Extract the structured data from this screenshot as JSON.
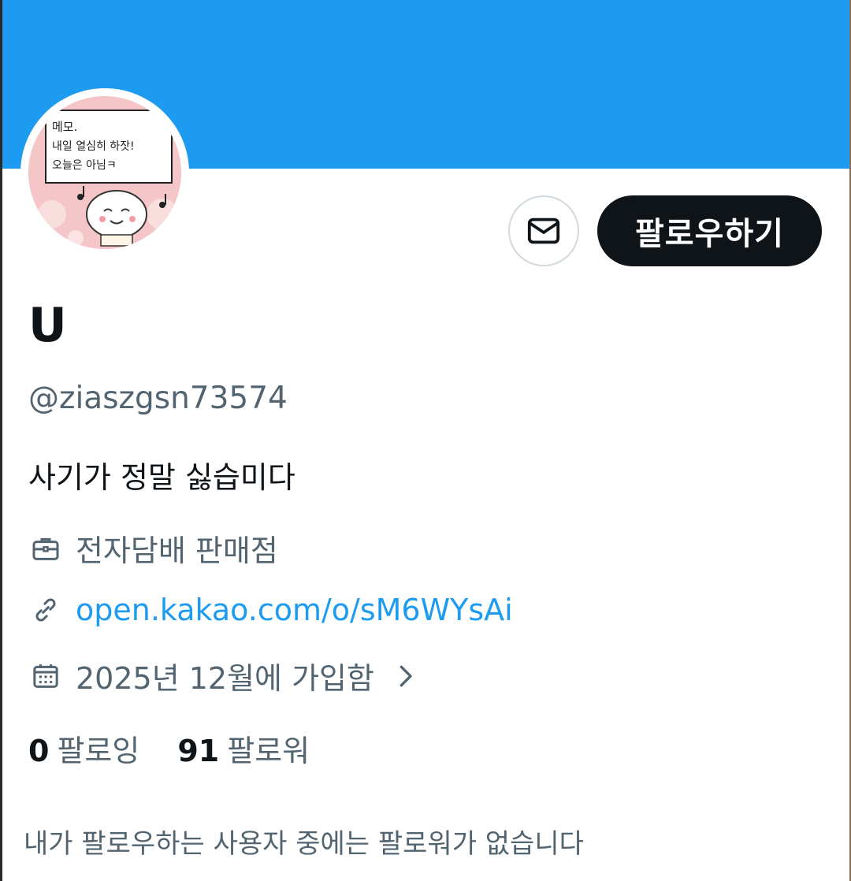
{
  "profile": {
    "display_name": "U",
    "handle": "@ziaszgsn73574",
    "bio": "사기가 정말 싫습미다",
    "work": "전자담배 판매점",
    "link": "open.kakao.com/o/sM6WYsAi",
    "joined": "2025년 12월에 가입함",
    "avatar_text": [
      "메모.",
      "내일 열심히 하잣!",
      "오늘은 아님ㅋ"
    ]
  },
  "actions": {
    "follow_label": "팔로우하기"
  },
  "stats": {
    "following_count": "0",
    "following_label": "팔로잉",
    "followers_count": "91",
    "followers_label": "팔로워"
  },
  "followers_note": "내가 팔로우하는 사용자 중에는 팔로워가 없습니다",
  "icons": {
    "dm": "envelope-icon",
    "work": "briefcase-icon",
    "link": "link-icon",
    "joined": "calendar-icon",
    "more": "chevron-right-icon"
  },
  "colors": {
    "banner": "#1d9bf0",
    "accent": "#1d9bf0",
    "text_primary": "#0f1419",
    "text_secondary": "#536471",
    "follow_button": "#0f1419"
  }
}
